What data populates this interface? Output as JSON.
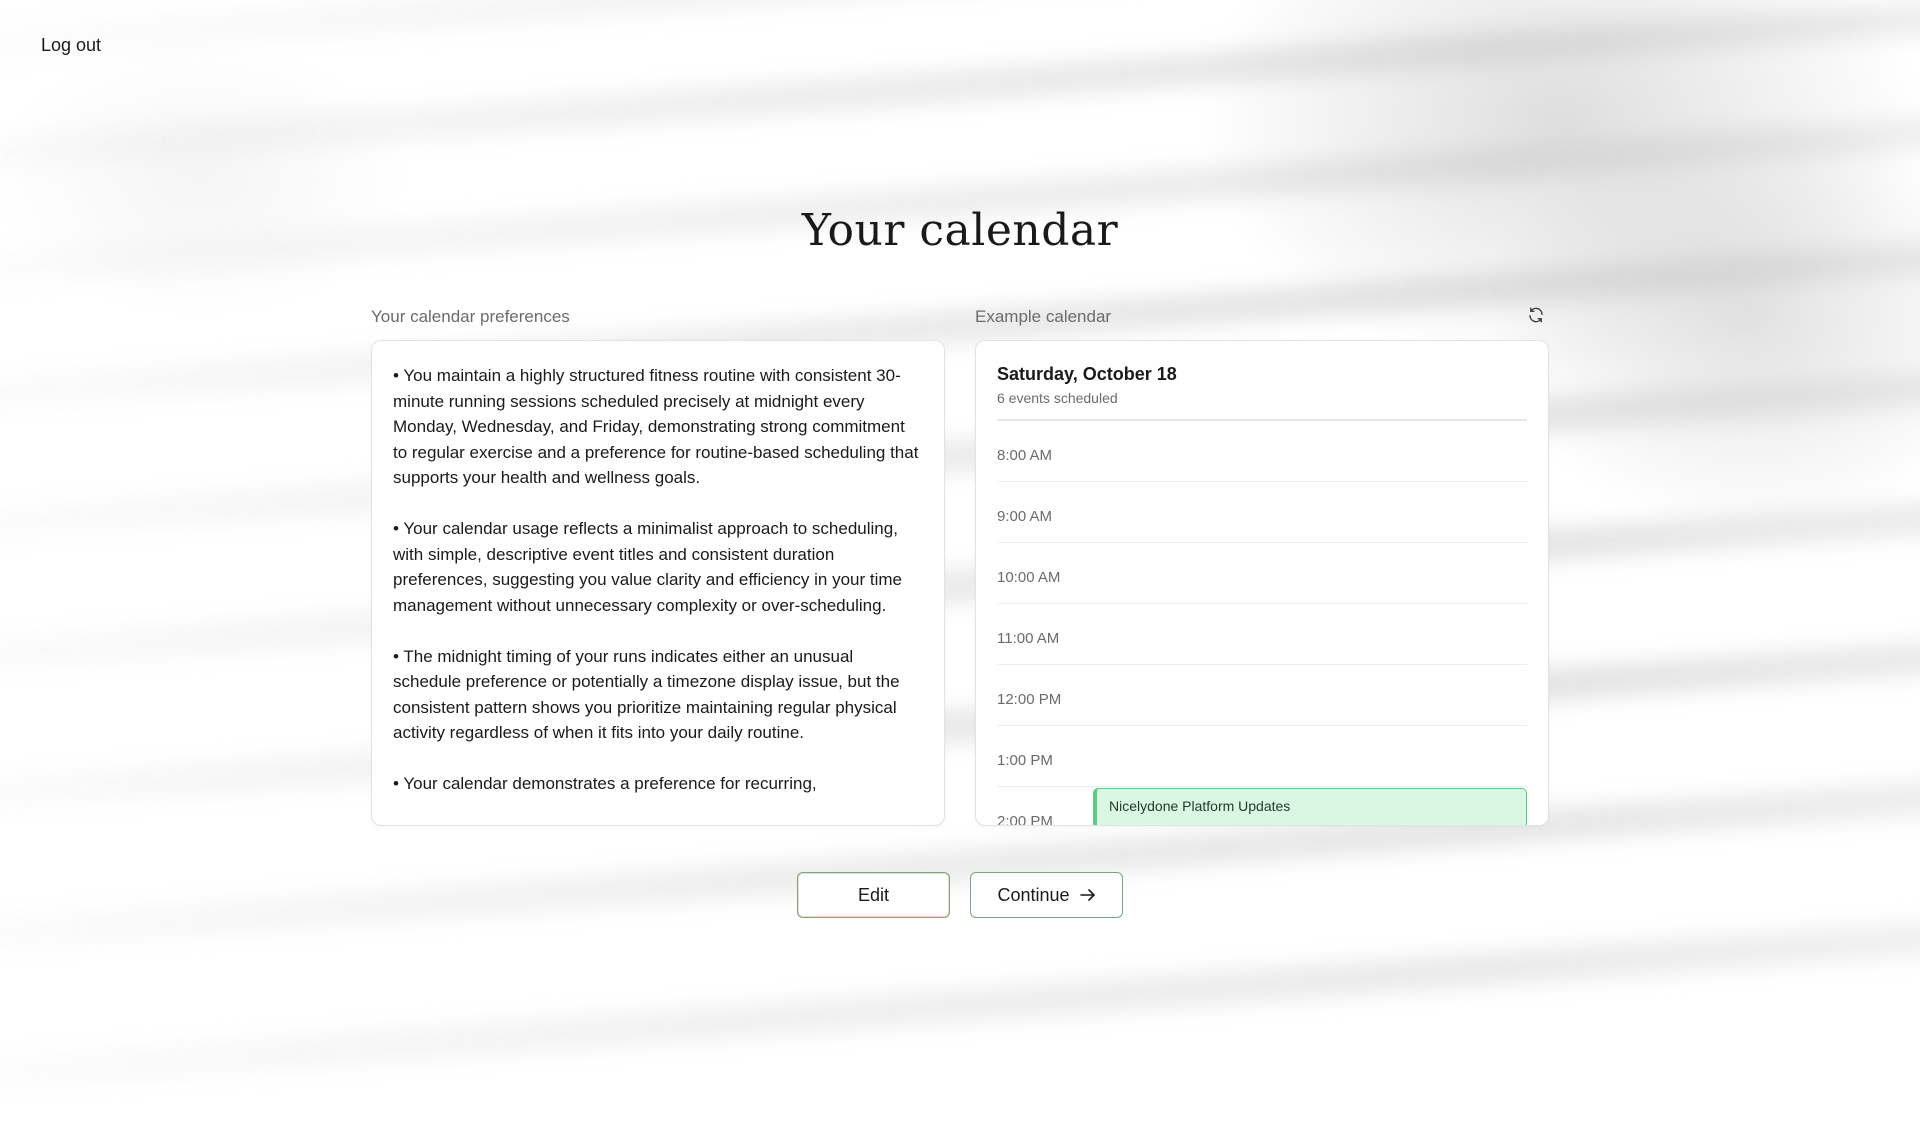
{
  "header": {
    "logout_label": "Log out",
    "title": "Your calendar"
  },
  "preferences": {
    "label": "Your calendar preferences",
    "paragraphs": [
      "• You maintain a highly structured fitness routine with consistent 30-minute running sessions scheduled precisely at midnight every Monday, Wednesday, and Friday, demonstrating strong commitment to regular exercise and a preference for routine-based scheduling that supports your health and wellness goals.",
      "• Your calendar usage reflects a minimalist approach to scheduling, with simple, descriptive event titles and consistent duration preferences, suggesting you value clarity and efficiency in your time management without unnecessary complexity or over-scheduling.",
      "• The midnight timing of your runs indicates either an unusual schedule preference or potentially a timezone display issue, but the consistent pattern shows you prioritize maintaining regular physical activity regardless of when it fits into your daily routine.",
      "• Your calendar demonstrates a preference for recurring,"
    ]
  },
  "calendar": {
    "label": "Example calendar",
    "refresh_icon": "refresh-icon",
    "date": "Saturday, October 18",
    "events_count": "6 events scheduled",
    "hours": [
      "8:00 AM",
      "9:00 AM",
      "10:00 AM",
      "11:00 AM",
      "12:00 PM",
      "1:00 PM",
      "2:00 PM"
    ],
    "event": {
      "title": "Nicelydone Platform Updates",
      "hour": "2:00 PM",
      "color": "#d9f7e3",
      "border_color": "#5ecb85"
    }
  },
  "actions": {
    "edit_label": "Edit",
    "continue_label": "Continue",
    "continue_icon": "arrow-right-icon"
  }
}
